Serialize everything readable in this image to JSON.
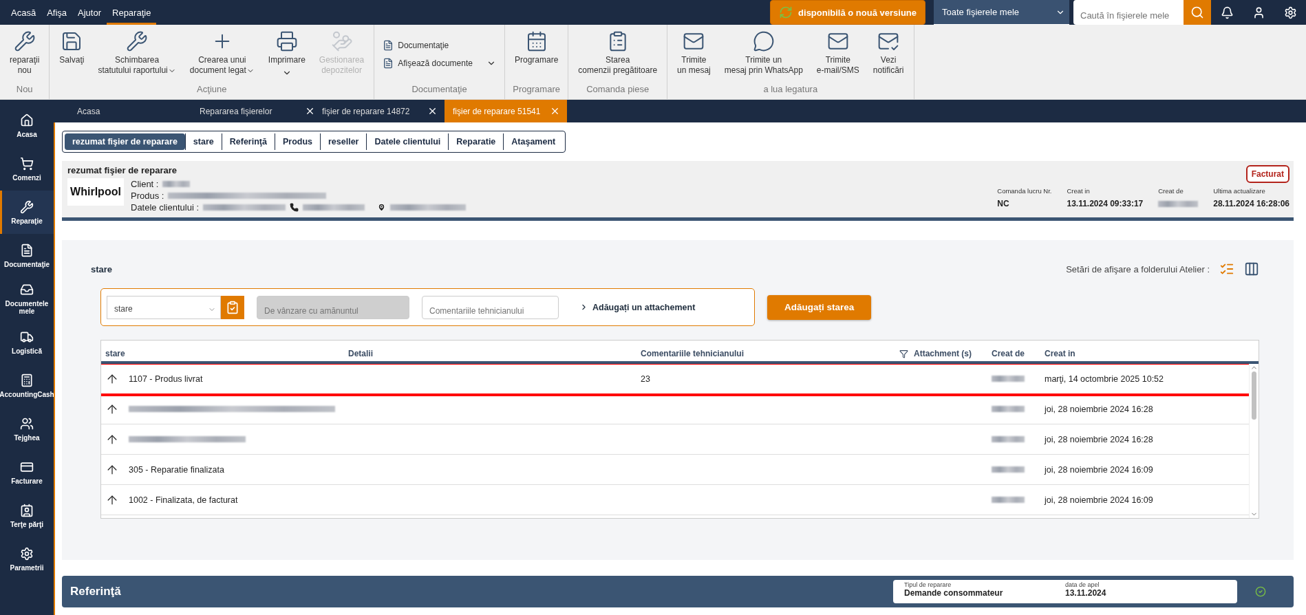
{
  "menu": [
    {
      "label": "Acasă",
      "selected": false
    },
    {
      "label": "Afişa",
      "selected": false
    },
    {
      "label": "Ajutor",
      "selected": false
    },
    {
      "label": "Reparaţie",
      "selected": true
    }
  ],
  "update_button": "disponibilă o nouă versiune",
  "scope_select": {
    "value": "Toate fişierele mele"
  },
  "search": {
    "placeholder": "Caută în fişierele mele"
  },
  "ribbon": [
    {
      "group": "Nou",
      "buttons": [
        {
          "kind": "large",
          "lines": [
            "reparaţii",
            "nou"
          ]
        }
      ]
    },
    {
      "group": "Acţiune",
      "buttons": [
        {
          "kind": "large",
          "lines": [
            "Salvaţi"
          ]
        },
        {
          "kind": "large",
          "lines": [
            "Schimbarea",
            "statutului raportului"
          ],
          "dropdown": true
        },
        {
          "kind": "large",
          "lines": [
            "Crearea unui",
            "document legat"
          ],
          "dropdown": true
        },
        {
          "kind": "large",
          "lines": [
            "Imprimare"
          ],
          "dropdown": true
        },
        {
          "kind": "large",
          "lines": [
            "Gestionarea",
            "depozitelor"
          ],
          "disabled": true
        }
      ]
    },
    {
      "group": "Documentaţie",
      "buttons": [
        {
          "kind": "small",
          "lines": [
            "Documentaţie"
          ]
        },
        {
          "kind": "small",
          "lines": [
            "Afişează documente"
          ],
          "dropdown": true
        }
      ]
    },
    {
      "group": "Programare",
      "buttons": [
        {
          "kind": "large",
          "lines": [
            "Programare"
          ]
        }
      ]
    },
    {
      "group": "Comanda piese",
      "buttons": [
        {
          "kind": "large",
          "lines": [
            "Starea",
            "comenzii pregătitoare"
          ]
        }
      ]
    },
    {
      "group": "a lua legatura",
      "buttons": [
        {
          "kind": "large",
          "lines": [
            "Trimite",
            "un mesaj"
          ]
        },
        {
          "kind": "large",
          "lines": [
            "Trimite un",
            "mesaj prin WhatsApp"
          ]
        },
        {
          "kind": "large",
          "lines": [
            "Trimite",
            "e-mail/SMS"
          ]
        },
        {
          "kind": "large",
          "lines": [
            "Vezi",
            "notificări"
          ]
        }
      ]
    }
  ],
  "sidebar": [
    {
      "label": "Acasa",
      "selected": false
    },
    {
      "label": "Comenzi",
      "selected": false
    },
    {
      "label": "Reparaţie",
      "selected": true
    },
    {
      "label": "Documentaţie",
      "selected": false
    },
    {
      "label": "Documentele mele",
      "selected": false
    },
    {
      "label": "Logistică",
      "selected": false
    },
    {
      "label": "AccountingCash",
      "selected": false
    },
    {
      "label": "Tejghea",
      "selected": false
    },
    {
      "label": "Facturare",
      "selected": false
    },
    {
      "label": "Terţe părţi",
      "selected": false
    },
    {
      "label": "Parametrii",
      "selected": false
    }
  ],
  "doc_tabs": [
    {
      "label": "Acasa",
      "closable": false,
      "selected": false
    },
    {
      "label": "Repararea fişierelor",
      "closable": true,
      "selected": false
    },
    {
      "label": "fişier de reparare 14872",
      "closable": true,
      "selected": false
    },
    {
      "label": "fişier de reparare 51541",
      "closable": true,
      "selected": true
    }
  ],
  "section_tabs": [
    {
      "label": "rezumat fişier de reparare",
      "selected": true
    },
    {
      "label": "stare",
      "selected": false
    },
    {
      "label": "Referinţă",
      "selected": false
    },
    {
      "label": "Produs",
      "selected": false
    },
    {
      "label": "reseller",
      "selected": false
    },
    {
      "label": "Datele clientului",
      "selected": false
    },
    {
      "label": "Reparatie",
      "selected": false
    },
    {
      "label": "Ataşament",
      "selected": false
    }
  ],
  "summary": {
    "title": "rezumat fişier de reparare",
    "brand_logo": "Whirlpool",
    "fields": [
      "Client :",
      "Produs :",
      "Datele clientului :"
    ],
    "badge": "Facturat",
    "meta": [
      {
        "label": "Comanda lucru Nr.",
        "value": "NC"
      },
      {
        "label": "Creat in",
        "value": "13.11.2024 09:33:17"
      },
      {
        "label": "Creat de"
      },
      {
        "label": "Ultima actualizare",
        "value": "28.11.2024 16:28:06"
      }
    ]
  },
  "status_panel": {
    "title": "stare",
    "display_settings_label": "Setări de afişare a folderului Atelier :",
    "view_modes": [
      {
        "kind": "list",
        "selected": true
      },
      {
        "kind": "columns",
        "selected": false
      }
    ],
    "form": {
      "status_select": {
        "value": "stare"
      },
      "retail_field": {
        "placeholder": "De vânzare cu amănuntul",
        "disabled": true
      },
      "comment_field": {
        "placeholder": "Comentariile tehnicianului"
      },
      "attachment_link": "Adăugați un attachement",
      "submit_button": "Adăugați starea"
    },
    "table": {
      "columns": [
        "stare",
        "Detalii",
        "Comentariile tehnicianului",
        "Attachment (s)",
        "Creat de",
        "Creat in"
      ],
      "rows": [
        {
          "status": "1107 - Produs livrat",
          "comment": "23",
          "created_in": "marţi, 14 octombrie 2025 10:52",
          "highlighted": true
        },
        {
          "created_in": "joi, 28 noiembrie 2024 16:28",
          "highlighted": false
        },
        {
          "created_in": "joi, 28 noiembrie 2024 16:28",
          "highlighted": false
        },
        {
          "status": "305 - Reparatie finalizata",
          "created_in": "joi, 28 noiembrie 2024 16:09",
          "highlighted": false
        },
        {
          "status": "1002 - Finalizata, de facturat",
          "created_in": "joi, 28 noiembrie 2024 16:09",
          "highlighted": false
        }
      ]
    }
  },
  "reference": {
    "title": "Referinţă",
    "fields": [
      {
        "label": "Tipul de reparare",
        "value": "Demande consommateur"
      },
      {
        "label": "data de apel",
        "value": "13.11.2024"
      }
    ]
  }
}
